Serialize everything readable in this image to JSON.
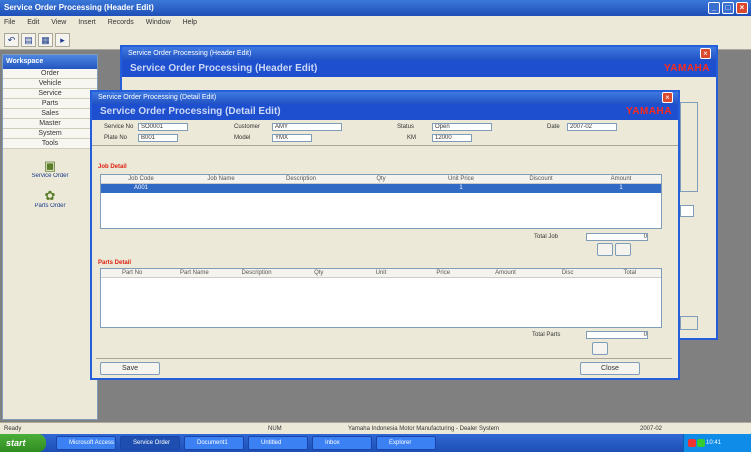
{
  "app_title": "Service Order Processing (Header Edit)",
  "menu": [
    "File",
    "Edit",
    "View",
    "Insert",
    "Records",
    "Window",
    "Help"
  ],
  "toolbar": {
    "undo": "↶",
    "open": "▤",
    "save": "▦",
    "go": "▸"
  },
  "nav": {
    "header": "Workspace",
    "items": [
      "Order",
      "Vehicle",
      "Service",
      "Parts",
      "Sales",
      "Master",
      "System",
      "Tools"
    ],
    "icons": [
      {
        "icon": "folder-icon",
        "label": "Service Order"
      },
      {
        "icon": "gear-icon",
        "label": "Parts Order"
      }
    ]
  },
  "back_window": {
    "title": "Service Order Processing (Header Edit)",
    "band": "Service Order Processing (Header Edit)",
    "brand": "YAMAHA"
  },
  "front_window": {
    "title": "Service Order Processing (Detail Edit)",
    "band": "Service Order Processing (Detail Edit)",
    "brand": "YAMAHA",
    "header": {
      "so_no_label": "Service No",
      "so_no": "SO0001",
      "cust_label": "Customer",
      "cust": "AMY",
      "status_label": "Status",
      "status": "Open",
      "date_label": "Date",
      "date": "2007-02",
      "plate_label": "Plate No",
      "plate": "B001",
      "model_label": "Model",
      "model": "YMX",
      "km_label": "KM",
      "km": "12000"
    },
    "jobs": {
      "title": "Job Detail",
      "columns": [
        "Job Code",
        "Job Name",
        "Description",
        "Qty",
        "Unit Price",
        "Discount",
        "Amount"
      ],
      "rows": [
        [
          "A001",
          "",
          "",
          "",
          "1",
          "",
          "1"
        ]
      ],
      "total_label": "Total Job",
      "total": "0"
    },
    "parts": {
      "title": "Parts Detail",
      "columns": [
        "Part No",
        "Part Name",
        "Description",
        "Qty",
        "Unit",
        "Price",
        "Amount",
        "Disc",
        "Total"
      ],
      "total_label": "Total Parts",
      "total": "0"
    },
    "footer": {
      "save_label": "Save",
      "close_label": "Close"
    }
  },
  "status_bar": [
    "Ready",
    "NUM",
    "Yamaha Indonesia Motor Manufacturing - Dealer System",
    "2007-02"
  ],
  "taskbar": {
    "start_label": "start",
    "tasks": [
      "Microsoft Access",
      "Service Order",
      "Document1",
      "Untitled",
      "Inbox",
      "Explorer"
    ],
    "clock": "10:41"
  },
  "colors": {
    "window_blue": "#245edb",
    "brand_red": "#ff2a1a",
    "selection": "#316ac5"
  }
}
